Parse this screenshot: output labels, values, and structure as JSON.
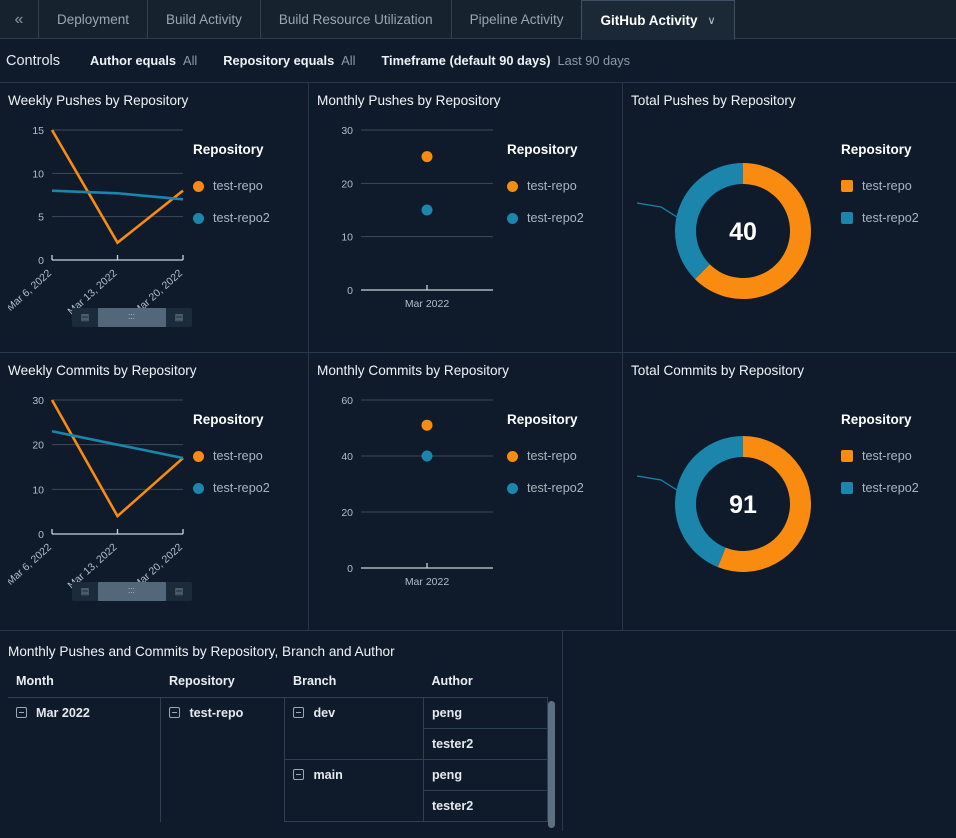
{
  "tabbar": {
    "collapse_icon": "«",
    "tabs": [
      {
        "label": "Deployment",
        "active": false
      },
      {
        "label": "Build Activity",
        "active": false
      },
      {
        "label": "Build Resource Utilization",
        "active": false
      },
      {
        "label": "Pipeline Activity",
        "active": false
      },
      {
        "label": "GitHub Activity",
        "active": true,
        "chevron": "∨"
      }
    ]
  },
  "controls": {
    "title": "Controls",
    "filters": [
      {
        "label": "Author equals",
        "value": "All"
      },
      {
        "label": "Repository equals",
        "value": "All"
      },
      {
        "label": "Timeframe (default 90 days)",
        "value": "Last 90 days"
      }
    ]
  },
  "colors": {
    "repo1": "#f88b10",
    "repo2": "#1b85ac",
    "background": "#0f1b2a",
    "panel_border": "#27384a",
    "text": "#e6ebef",
    "muted_text": "#8d9aa7"
  },
  "legend": {
    "title": "Repository",
    "items": [
      {
        "label": "test-repo",
        "color": "#f88b10"
      },
      {
        "label": "test-repo2",
        "color": "#1b85ac"
      }
    ]
  },
  "chart_data": [
    {
      "type": "line",
      "title": "Weekly Pushes by Repository",
      "xlabel": "",
      "ylabel": "",
      "categories": [
        "Mar 6, 2022",
        "Mar 13, 2022",
        "Mar 20, 2022"
      ],
      "yticks": [
        0,
        5,
        10,
        15
      ],
      "ylim": [
        0,
        15
      ],
      "grid": true,
      "legend_position": "right",
      "legend_title": "Repository",
      "series": [
        {
          "name": "test-repo",
          "color": "#f88b10",
          "values": [
            15,
            2,
            8
          ]
        },
        {
          "name": "test-repo2",
          "color": "#1b85ac",
          "values": [
            8,
            7.7,
            7
          ]
        }
      ],
      "has_x_scrollbar": true
    },
    {
      "type": "scatter",
      "title": "Monthly Pushes by Repository",
      "xlabel": "",
      "ylabel": "",
      "categories": [
        "Mar 2022"
      ],
      "yticks": [
        0,
        10,
        20,
        30
      ],
      "ylim": [
        0,
        30
      ],
      "grid": true,
      "legend_position": "right",
      "legend_title": "Repository",
      "series": [
        {
          "name": "test-repo",
          "color": "#f88b10",
          "values": [
            25
          ]
        },
        {
          "name": "test-repo2",
          "color": "#1b85ac",
          "values": [
            15
          ]
        }
      ],
      "has_x_scrollbar": false
    },
    {
      "type": "pie",
      "title": "Total Pushes by Repository",
      "center_value": "40",
      "legend_position": "right",
      "legend_title": "Repository",
      "labels": [
        "test-repo",
        "test-repo2"
      ],
      "values": [
        25,
        15
      ],
      "colors": [
        "#f88b10",
        "#1b85ac"
      ],
      "donut": true
    },
    {
      "type": "line",
      "title": "Weekly Commits by Repository",
      "xlabel": "",
      "ylabel": "",
      "categories": [
        "Mar 6, 2022",
        "Mar 13, 2022",
        "Mar 20, 2022"
      ],
      "yticks": [
        0,
        10,
        20,
        30
      ],
      "ylim": [
        0,
        30
      ],
      "grid": true,
      "legend_position": "right",
      "legend_title": "Repository",
      "series": [
        {
          "name": "test-repo",
          "color": "#f88b10",
          "values": [
            30,
            4,
            17
          ]
        },
        {
          "name": "test-repo2",
          "color": "#1b85ac",
          "values": [
            23,
            20,
            17
          ]
        }
      ],
      "has_x_scrollbar": true
    },
    {
      "type": "scatter",
      "title": "Monthly Commits by Repository",
      "xlabel": "",
      "ylabel": "",
      "categories": [
        "Mar 2022"
      ],
      "yticks": [
        0,
        20,
        40,
        60
      ],
      "ylim": [
        0,
        60
      ],
      "grid": true,
      "legend_position": "right",
      "legend_title": "Repository",
      "series": [
        {
          "name": "test-repo",
          "color": "#f88b10",
          "values": [
            51
          ]
        },
        {
          "name": "test-repo2",
          "color": "#1b85ac",
          "values": [
            40
          ]
        }
      ],
      "has_x_scrollbar": false
    },
    {
      "type": "pie",
      "title": "Total Commits by Repository",
      "center_value": "91",
      "legend_position": "right",
      "legend_title": "Repository",
      "labels": [
        "test-repo",
        "test-repo2"
      ],
      "values": [
        51,
        40
      ],
      "colors": [
        "#f88b10",
        "#1b85ac"
      ],
      "donut": true
    }
  ],
  "table": {
    "title": "Monthly Pushes and Commits by Repository, Branch and Author",
    "columns": [
      "Month",
      "Repository",
      "Branch",
      "Author"
    ],
    "rows": [
      {
        "month": "Mar 2022",
        "repository": "test-repo",
        "branch": "dev",
        "author": "peng"
      },
      {
        "month": "",
        "repository": "",
        "branch": "",
        "author": "tester2"
      },
      {
        "month": "",
        "repository": "",
        "branch": "main",
        "author": "peng"
      },
      {
        "month": "",
        "repository": "",
        "branch": "",
        "author": "tester2"
      }
    ]
  }
}
